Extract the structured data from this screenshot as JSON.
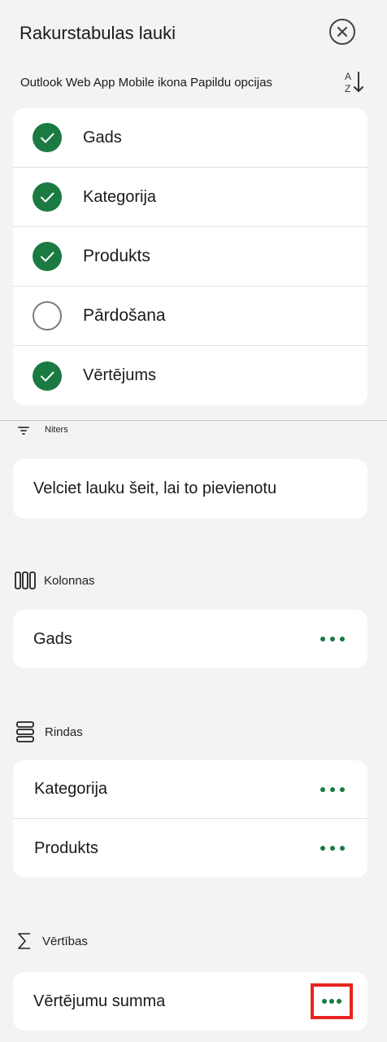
{
  "header": {
    "title": "Rakurstabulas lauki",
    "subtitle": "Outlook Web App Mobile ikona Papildu opcijas"
  },
  "fields": [
    {
      "label": "Gads",
      "checked": true
    },
    {
      "label": "Kategorija",
      "checked": true
    },
    {
      "label": "Produkts",
      "checked": true
    },
    {
      "label": "Pārdošana",
      "checked": false
    },
    {
      "label": "Vērtējums",
      "checked": true
    }
  ],
  "filters": {
    "label": "Niters",
    "drop_text": "Velciet lauku šeit, lai to pievienotu"
  },
  "columns": {
    "label": "Kolonnas",
    "items": [
      "Gads"
    ]
  },
  "rows": {
    "label": "Rindas",
    "items": [
      "Kategorija",
      "Produkts"
    ]
  },
  "values": {
    "label": "Vērtības",
    "items": [
      "Vērtējumu summa"
    ]
  },
  "colors": {
    "accent": "#1a7a41",
    "highlight": "#e8241f"
  }
}
